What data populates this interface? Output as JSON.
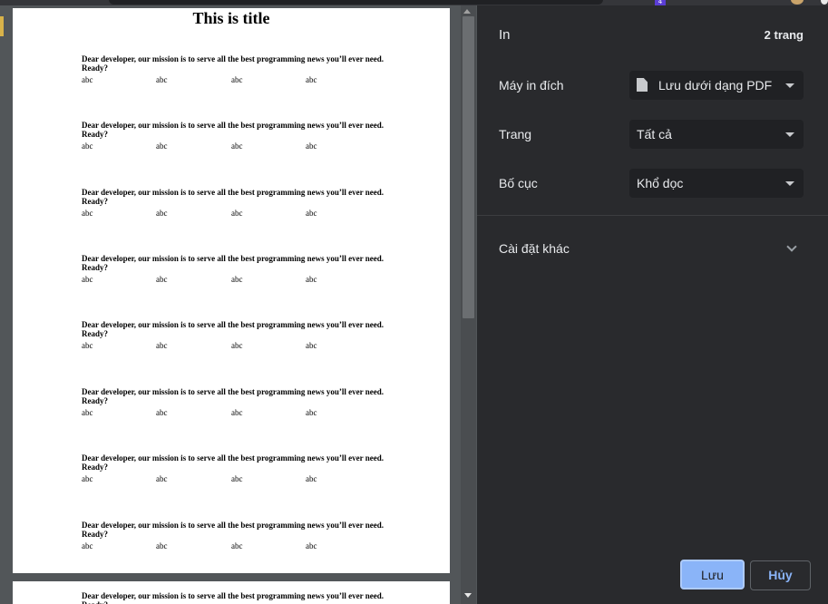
{
  "chrome": {
    "badge": "4"
  },
  "document": {
    "title": "This is title",
    "message": "Dear developer, our mission is to serve all the best programming news you’ll ever need. Ready?",
    "cells": [
      "abc",
      "abc",
      "abc",
      "abc"
    ]
  },
  "panel": {
    "title": "In",
    "page_count": "2 trang",
    "destination": {
      "label": "Máy in đích",
      "value": "Lưu dưới dạng PDF",
      "icon": "file-icon"
    },
    "pages": {
      "label": "Trang",
      "value": "Tất cả"
    },
    "layout": {
      "label": "Bố cục",
      "value": "Khổ dọc"
    },
    "more_settings": {
      "label": "Cài đặt khác",
      "icon": "chevron-down-icon"
    },
    "save_label": "Lưu",
    "cancel_label": "Hủy"
  },
  "colors": {
    "accent": "#8ab4f8",
    "panel_bg": "#292a2d",
    "preview_bg": "#525659",
    "select_bg": "#202124"
  }
}
